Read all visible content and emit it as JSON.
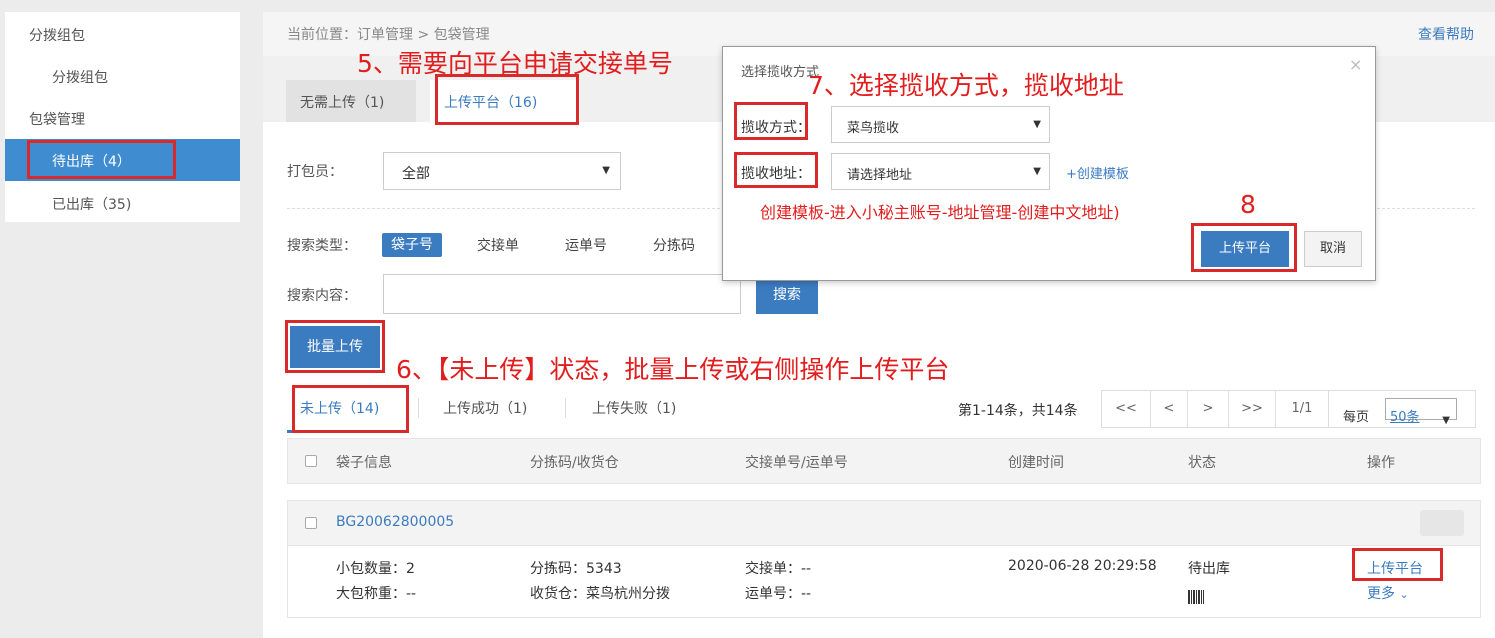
{
  "sidebar": {
    "group1": "分拨组包",
    "item1": "分拨组包",
    "group2": "包袋管理",
    "item_active": "待出库（4）",
    "item3": "已出库（35)"
  },
  "breadcrumb": "当前位置：订单管理 > 包袋管理",
  "help": "查看帮助",
  "tabs": [
    "无需上传（1)",
    "上传平台（16)"
  ],
  "filters": {
    "packer_label": "打包员：",
    "packer_value": "全部",
    "search_type_label": "搜索类型：",
    "search_types": [
      "袋子号",
      "交接单",
      "运单号",
      "分拣码"
    ],
    "search_content_label": "搜索内容：",
    "search_button": "搜索"
  },
  "batch_button": "批量上传",
  "subtabs": [
    "未上传（14)",
    "上传成功（1)",
    "上传失败（1)"
  ],
  "pagination": {
    "summary": "第1-14条，共14条",
    "first": "<<",
    "prev": "<",
    "next": ">",
    "last": ">>",
    "page": "1/1",
    "per_page_label": "每页",
    "per_page_value": "50条"
  },
  "table": {
    "headers": [
      "袋子信息",
      "分拣码/收货仓",
      "交接单号/运单号",
      "创建时间",
      "状态",
      "操作"
    ],
    "row": {
      "id": "BG20062800005",
      "small_count": "小包数量：2",
      "big_weight": "大包称重：--",
      "sort_code": "分拣码：5343",
      "warehouse": "收货仓：菜鸟杭州分拨",
      "handover": "交接单：--",
      "waybill": "运单号：--",
      "created": "2020-06-28 20:29:58",
      "status": "待出库",
      "action_upload": "上传平台",
      "action_more": "更多"
    }
  },
  "modal": {
    "title": "选择揽收方式",
    "close": "×",
    "method_label": "揽收方式：",
    "method_value": "菜鸟揽收",
    "address_label": "揽收地址：",
    "address_value": "请选择地址",
    "create_template": "+创建模板",
    "hint": "创建模板-进入小秘主账号-地址管理-创建中文地址)",
    "confirm": "上传平台",
    "cancel": "取消"
  },
  "annotations": {
    "step5": "5、需要向平台申请交接单号",
    "step6": "6、【未上传】状态，批量上传或右侧操作上传平台",
    "step7": "7、选择揽收方式，揽收地址",
    "step8": "8"
  },
  "colors": {
    "accent": "#3b7bc0",
    "sidebar_active": "#3f8cd0",
    "annotation": "#e21d1d"
  }
}
